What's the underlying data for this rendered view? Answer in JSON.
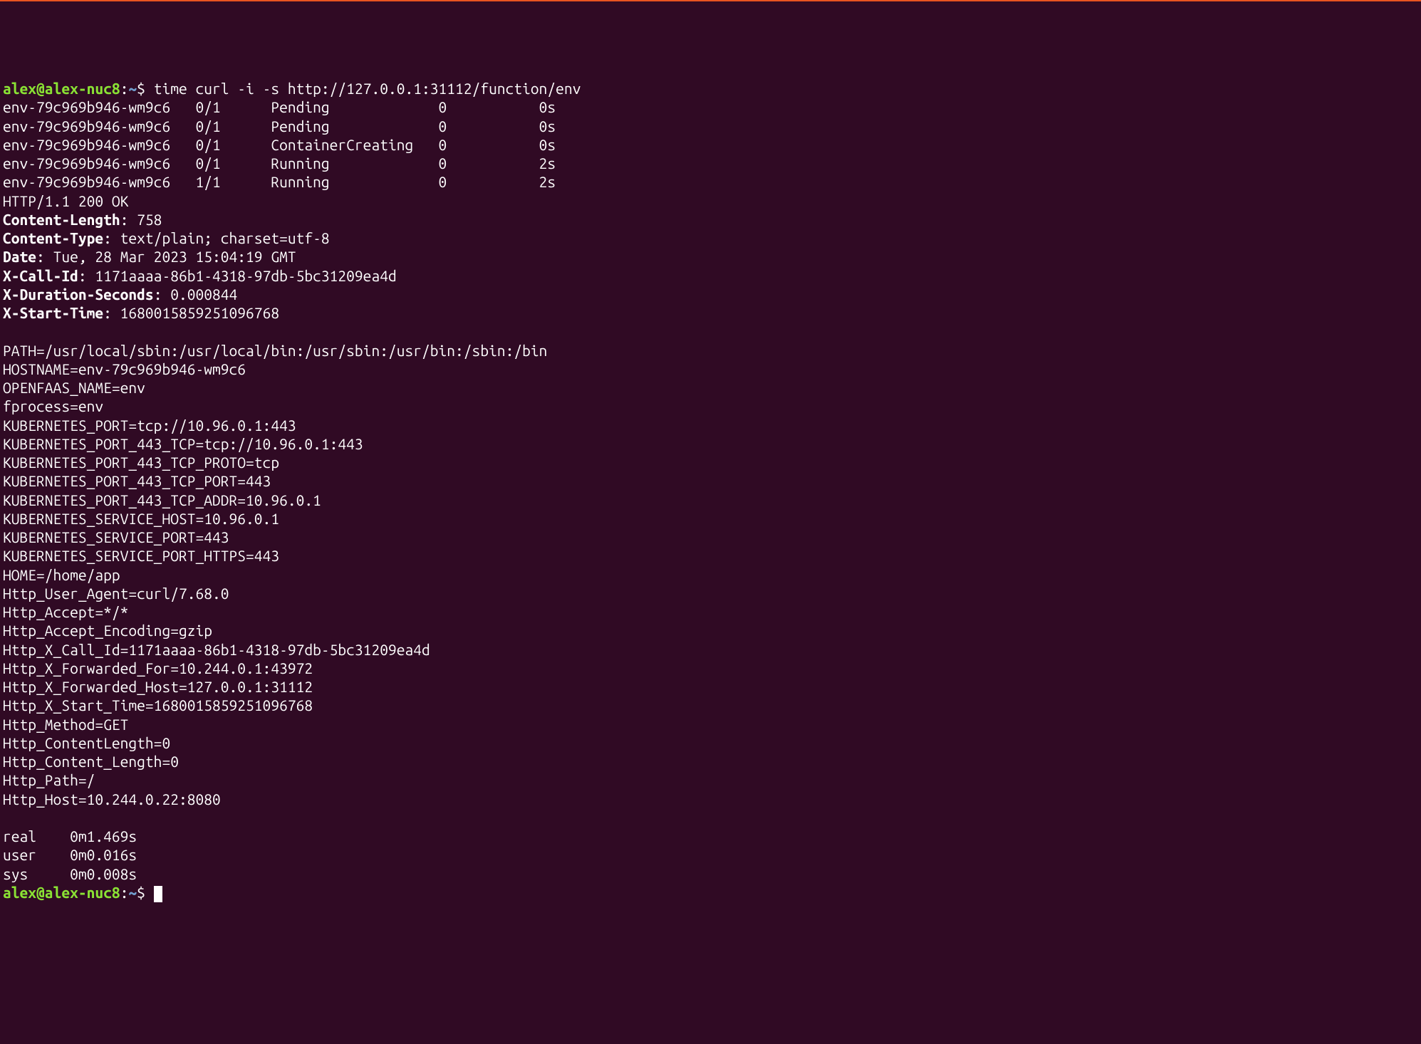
{
  "prompt": {
    "userhost": "alex@alex-nuc8",
    "sep1": ":",
    "path": "~",
    "sep2": "$ "
  },
  "command": "time curl -i -s http://127.0.0.1:31112/function/env",
  "pods": [
    {
      "name": "env-79c969b946-wm9c6",
      "ready": "0/1",
      "status": "Pending",
      "restarts": "0",
      "age": "0s"
    },
    {
      "name": "env-79c969b946-wm9c6",
      "ready": "0/1",
      "status": "Pending",
      "restarts": "0",
      "age": "0s"
    },
    {
      "name": "env-79c969b946-wm9c6",
      "ready": "0/1",
      "status": "ContainerCreating",
      "restarts": "0",
      "age": "0s"
    },
    {
      "name": "env-79c969b946-wm9c6",
      "ready": "0/1",
      "status": "Running",
      "restarts": "0",
      "age": "2s"
    },
    {
      "name": "env-79c969b946-wm9c6",
      "ready": "1/1",
      "status": "Running",
      "restarts": "0",
      "age": "2s"
    }
  ],
  "http_status": "HTTP/1.1 200 OK",
  "headers": [
    {
      "k": "Content-Length",
      "v": ": 758"
    },
    {
      "k": "Content-Type",
      "v": ": text/plain; charset=utf-8"
    },
    {
      "k": "Date",
      "v": ": Tue, 28 Mar 2023 15:04:19 GMT"
    },
    {
      "k": "X-Call-Id",
      "v": ": 1171aaaa-86b1-4318-97db-5bc31209ea4d"
    },
    {
      "k": "X-Duration-Seconds",
      "v": ": 0.000844"
    },
    {
      "k": "X-Start-Time",
      "v": ": 1680015859251096768"
    }
  ],
  "body_lines": [
    "PATH=/usr/local/sbin:/usr/local/bin:/usr/sbin:/usr/bin:/sbin:/bin",
    "HOSTNAME=env-79c969b946-wm9c6",
    "OPENFAAS_NAME=env",
    "fprocess=env",
    "KUBERNETES_PORT=tcp://10.96.0.1:443",
    "KUBERNETES_PORT_443_TCP=tcp://10.96.0.1:443",
    "KUBERNETES_PORT_443_TCP_PROTO=tcp",
    "KUBERNETES_PORT_443_TCP_PORT=443",
    "KUBERNETES_PORT_443_TCP_ADDR=10.96.0.1",
    "KUBERNETES_SERVICE_HOST=10.96.0.1",
    "KUBERNETES_SERVICE_PORT=443",
    "KUBERNETES_SERVICE_PORT_HTTPS=443",
    "HOME=/home/app",
    "Http_User_Agent=curl/7.68.0",
    "Http_Accept=*/*",
    "Http_Accept_Encoding=gzip",
    "Http_X_Call_Id=1171aaaa-86b1-4318-97db-5bc31209ea4d",
    "Http_X_Forwarded_For=10.244.0.1:43972",
    "Http_X_Forwarded_Host=127.0.0.1:31112",
    "Http_X_Start_Time=1680015859251096768",
    "Http_Method=GET",
    "Http_ContentLength=0",
    "Http_Content_Length=0",
    "Http_Path=/",
    "Http_Host=10.244.0.22:8080"
  ],
  "timing": [
    {
      "label": "real",
      "value": "0m1.469s"
    },
    {
      "label": "user",
      "value": "0m0.016s"
    },
    {
      "label": "sys",
      "value": "0m0.008s"
    }
  ]
}
